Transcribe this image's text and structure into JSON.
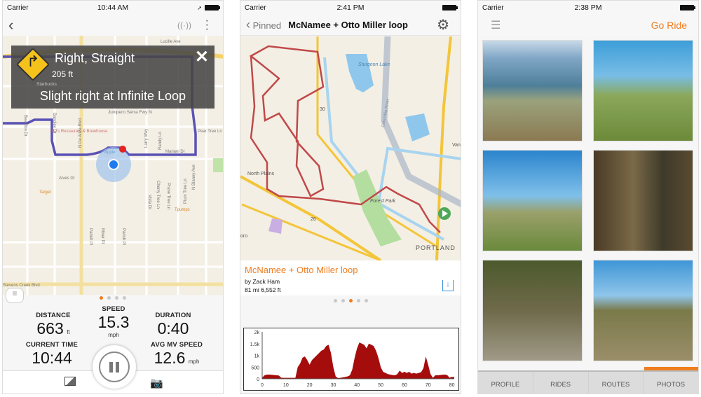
{
  "screen1": {
    "status": {
      "carrier": "Carrier",
      "time": "10:44 AM"
    },
    "turn": {
      "title": "Right, Straight",
      "distance": "205 ft",
      "instruction": "Slight right at Infinite Loop"
    },
    "map_labels": [
      "Lucille Ave",
      "Beardon Dr",
      "BJ's Restaurant & Brewhouse",
      "Apple",
      "Larry Way",
      "Randy Ln",
      "N De Anza Blvd",
      "Bandley Dr",
      "Mariani Dr",
      "Cherry Tree Ln",
      "Prune Tree Ln",
      "Plum Tree Ln",
      "Vista Dr",
      "Pear Tree Ln",
      "Parlett Pl",
      "Miner Pl",
      "Parish Pl",
      "Alves Dr",
      "Target",
      "N Blaney Ave",
      "Tpumps",
      "Stevens Creek Blvd",
      "Starbucks",
      "Junipero Serra Fwy N"
    ],
    "stats": {
      "distance": {
        "label": "DISTANCE",
        "value": "663",
        "unit": "ft"
      },
      "speed": {
        "label": "SPEED",
        "value": "15.3",
        "unit": "mph"
      },
      "duration": {
        "label": "DURATION",
        "value": "0:40"
      },
      "current_time": {
        "label": "CURRENT TIME",
        "value": "10:44"
      },
      "avg_speed": {
        "label": "AVG MV SPEED",
        "value": "12.6",
        "unit": "mph"
      }
    },
    "page_index": 0,
    "page_count": 4,
    "icons": [
      "back-icon",
      "antenna-icon",
      "more-icon",
      "close-icon",
      "menu-icon",
      "pause-icon",
      "photo-icon",
      "camera-icon"
    ]
  },
  "screen2": {
    "status": {
      "carrier": "Carrier",
      "time": "2:41 PM"
    },
    "nav": {
      "back_label": "Pinned",
      "title": "McNamee + Otto Miller loop"
    },
    "map_labels": [
      "Sturgeon Lake",
      "Columbia River",
      "30",
      "Van",
      "North Plains",
      "Forest Park",
      "26",
      "oro",
      "PORTLAND"
    ],
    "route": {
      "title": "McNamee + Otto Miller loop",
      "author": "by Zack Ham",
      "stats": "81 mi 6,552 ft"
    },
    "page_index": 2,
    "page_count": 5,
    "accent": "#f07d1f",
    "chart_data": {
      "type": "area",
      "x": [
        0,
        1,
        2,
        3,
        4,
        5,
        6,
        7,
        8,
        9,
        10,
        11,
        12,
        13,
        14,
        15,
        16,
        17,
        18,
        19,
        20,
        21,
        22,
        23,
        24,
        25,
        26,
        27,
        28,
        29,
        30,
        31,
        32,
        33,
        34,
        35,
        36,
        37,
        38,
        39,
        40,
        41,
        42,
        43,
        44,
        45,
        46,
        47,
        48,
        49,
        50,
        51,
        52,
        53,
        54,
        55,
        56,
        57,
        58,
        59,
        60,
        61,
        62,
        63,
        64,
        65,
        66,
        67,
        68,
        69,
        70,
        71,
        72,
        73,
        74,
        75,
        76,
        77,
        78,
        79,
        80,
        81
      ],
      "series": [
        {
          "values": [
            50,
            150,
            180,
            180,
            170,
            160,
            150,
            140,
            50,
            40,
            40,
            40,
            40,
            40,
            40,
            500,
            650,
            900,
            950,
            800,
            600,
            800,
            900,
            1000,
            1100,
            1200,
            1250,
            1400,
            1450,
            1100,
            500,
            100,
            30,
            40,
            60,
            80,
            100,
            150,
            400,
            900,
            1300,
            1550,
            1500,
            1450,
            1300,
            1500,
            1450,
            1400,
            1200,
            900,
            500,
            300,
            250,
            200,
            180,
            160,
            150,
            200,
            350,
            250,
            300,
            250,
            300,
            220,
            250,
            220,
            250,
            280,
            450,
            950,
            600,
            200,
            40,
            150,
            150,
            160,
            170,
            180,
            160,
            50,
            80,
            80
          ]
        }
      ],
      "xticks": [
        "0",
        "10",
        "20",
        "30",
        "40",
        "50",
        "60",
        "70",
        "80"
      ],
      "yticks": [
        "0",
        "500",
        "1k",
        "1.5k",
        "2k"
      ],
      "xlim": [
        0,
        81
      ],
      "ylim": [
        0,
        2000
      ],
      "color": "#a50d0d"
    }
  },
  "screen3": {
    "status": {
      "carrier": "Carrier",
      "time": "2:38 PM"
    },
    "nav": {
      "action": "Go Ride"
    },
    "tabs": [
      "PROFILE",
      "RIDES",
      "ROUTES",
      "PHOTOS"
    ],
    "active_tab": 3
  }
}
